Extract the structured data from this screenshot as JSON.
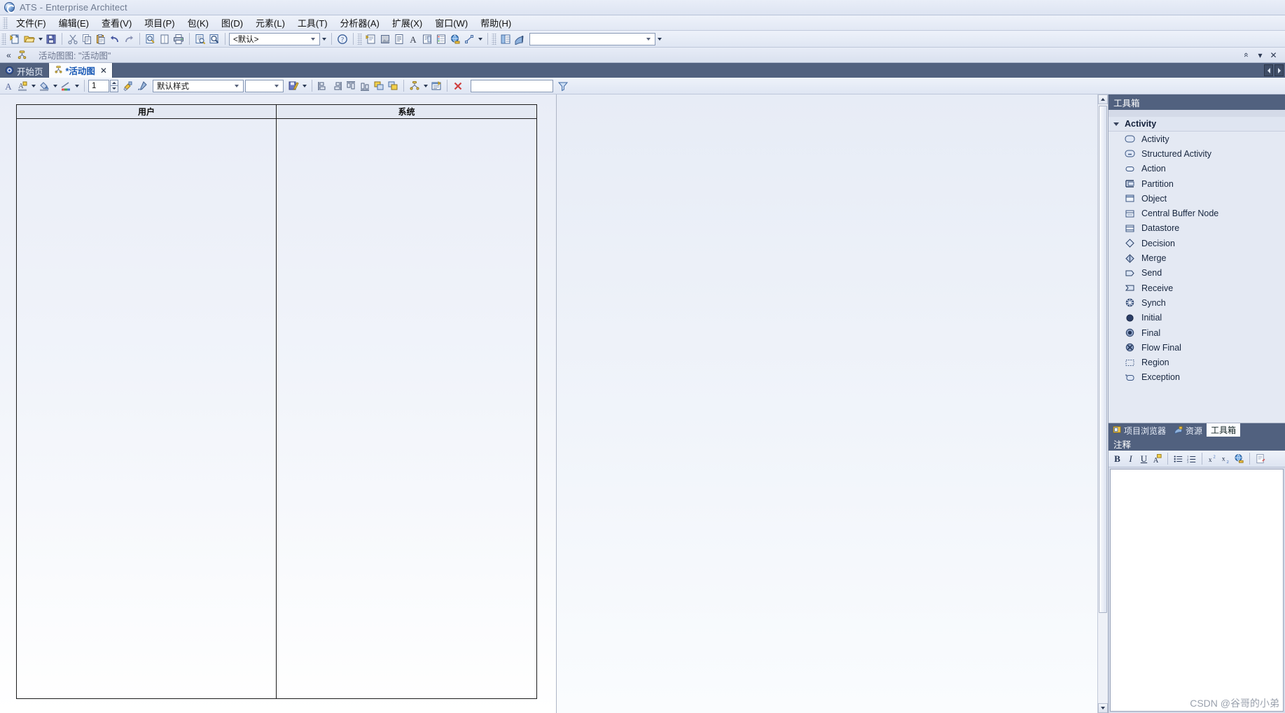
{
  "window": {
    "title": "ATS - Enterprise Architect",
    "logo_icon": "ea-logo-icon"
  },
  "menubar": {
    "items": [
      {
        "label": "文件(F)"
      },
      {
        "label": "编辑(E)"
      },
      {
        "label": "查看(V)"
      },
      {
        "label": "项目(P)"
      },
      {
        "label": "包(K)"
      },
      {
        "label": "图(D)"
      },
      {
        "label": "元素(L)"
      },
      {
        "label": "工具(T)"
      },
      {
        "label": "分析器(A)"
      },
      {
        "label": "扩展(X)"
      },
      {
        "label": "窗口(W)"
      },
      {
        "label": "帮助(H)"
      }
    ]
  },
  "main_toolbar": {
    "buttons": [
      {
        "name": "new-file-icon"
      },
      {
        "name": "open-file-icon"
      },
      {
        "name": "open-file-dropdown-icon"
      },
      {
        "name": "save-icon"
      },
      {
        "name": "cut-icon"
      },
      {
        "name": "copy-icon"
      },
      {
        "name": "paste-icon"
      },
      {
        "name": "undo-icon"
      },
      {
        "name": "redo-icon"
      },
      {
        "name": "find-in-project-icon"
      },
      {
        "name": "new-element-icon"
      },
      {
        "name": "print-icon"
      },
      {
        "name": "print-preview-icon"
      },
      {
        "name": "zoom-search-icon"
      },
      {
        "name": "help-icon"
      },
      {
        "name": "properties-icon"
      },
      {
        "name": "image-icon"
      },
      {
        "name": "notes-icon"
      },
      {
        "name": "font-icon"
      },
      {
        "name": "documentation-icon"
      },
      {
        "name": "tagged-values-icon"
      },
      {
        "name": "web-icon"
      },
      {
        "name": "relationships-icon"
      },
      {
        "name": "relationships-dropdown-icon"
      },
      {
        "name": "layout-icon"
      },
      {
        "name": "model-views-icon"
      }
    ],
    "perspective_combo": {
      "value": "<默认>",
      "name": "perspective-combo"
    },
    "search_combo": {
      "value": "",
      "name": "toolbar-search-combo"
    }
  },
  "breadcrumb": {
    "back_icon": "collapse-back-icon",
    "diagram_icon": "activity-diagram-icon",
    "text": "活动图图: \"活动图\"",
    "buttons": [
      {
        "name": "pin-up-icon",
        "glyph": "«"
      },
      {
        "name": "dropdown-icon",
        "glyph": "▾"
      },
      {
        "name": "close-icon",
        "glyph": "✕"
      }
    ]
  },
  "tabs": {
    "items": [
      {
        "label": "开始页",
        "icon": "start-page-icon",
        "active": false,
        "closable": false
      },
      {
        "label": "*活动图",
        "icon": "activity-diagram-icon",
        "active": true,
        "closable": true,
        "close_glyph": "✕"
      }
    ]
  },
  "format_toolbar": {
    "buttons": [
      {
        "name": "font-color-icon"
      },
      {
        "name": "text-highlight-icon"
      },
      {
        "name": "text-highlight-dropdown-icon"
      },
      {
        "name": "fill-color-icon"
      },
      {
        "name": "fill-color-dropdown-icon"
      },
      {
        "name": "line-style-icon"
      },
      {
        "name": "line-style-dropdown-icon"
      }
    ],
    "line_width": {
      "value": "1",
      "name": "line-width-spinner"
    },
    "brush_icon": "format-painter-icon",
    "picker_icon": "color-picker-icon",
    "style_combo": {
      "value": "默认样式",
      "name": "style-combo"
    },
    "empty_combo": {
      "value": "",
      "name": "secondary-style-combo"
    },
    "right_buttons": [
      {
        "name": "save-style-icon"
      },
      {
        "name": "save-style-dropdown-icon"
      },
      {
        "name": "align-left-icon"
      },
      {
        "name": "align-right-icon"
      },
      {
        "name": "align-top-icon"
      },
      {
        "name": "align-bottom-icon"
      },
      {
        "name": "same-width-icon"
      },
      {
        "name": "same-height-icon"
      },
      {
        "name": "auto-layout-icon"
      },
      {
        "name": "auto-layout-dropdown-icon"
      },
      {
        "name": "diagram-properties-icon"
      },
      {
        "name": "delete-icon"
      }
    ],
    "filter_input": {
      "value": "",
      "name": "filter-input"
    },
    "filter_icon": "funnel-filter-icon"
  },
  "diagram": {
    "name": "activity-diagram-canvas",
    "lanes": [
      {
        "label": "用户",
        "name": "swimlane-user"
      },
      {
        "label": "系统",
        "name": "swimlane-system"
      }
    ],
    "scrollbar": {
      "up_icon": "scroll-up-icon",
      "down_icon": "scroll-down-icon"
    }
  },
  "toolbox": {
    "title": "工具箱",
    "group": {
      "label": "Activity",
      "collapsed": false
    },
    "items": [
      {
        "label": "Activity",
        "icon": "activity-shape-icon"
      },
      {
        "label": "Structured Activity",
        "icon": "structured-activity-shape-icon"
      },
      {
        "label": "Action",
        "icon": "action-shape-icon"
      },
      {
        "label": "Partition",
        "icon": "partition-shape-icon"
      },
      {
        "label": "Object",
        "icon": "object-shape-icon"
      },
      {
        "label": "Central Buffer Node",
        "icon": "central-buffer-node-icon"
      },
      {
        "label": "Datastore",
        "icon": "datastore-icon"
      },
      {
        "label": "Decision",
        "icon": "decision-diamond-icon"
      },
      {
        "label": "Merge",
        "icon": "merge-diamond-icon"
      },
      {
        "label": "Send",
        "icon": "send-signal-icon"
      },
      {
        "label": "Receive",
        "icon": "receive-signal-icon"
      },
      {
        "label": "Synch",
        "icon": "synch-bar-icon"
      },
      {
        "label": "Initial",
        "icon": "initial-node-icon"
      },
      {
        "label": "Final",
        "icon": "final-node-icon"
      },
      {
        "label": "Flow Final",
        "icon": "flow-final-node-icon"
      },
      {
        "label": "Region",
        "icon": "region-icon"
      },
      {
        "label": "Exception",
        "icon": "exception-icon"
      }
    ],
    "dock_buttons": [
      {
        "name": "collapse-panel-icon",
        "glyph": "«"
      },
      {
        "name": "panel-menu-icon",
        "glyph": "▾"
      },
      {
        "name": "close-panel-icon",
        "glyph": "✕"
      }
    ]
  },
  "dock_tabs": {
    "items": [
      {
        "label": "项目浏览器",
        "icon": "project-browser-icon",
        "active": false
      },
      {
        "label": "资源",
        "icon": "resources-icon",
        "active": false
      },
      {
        "label": "工具箱",
        "icon": "toolbox-icon",
        "active": true
      }
    ]
  },
  "notes": {
    "title": "注释",
    "toolbar": [
      {
        "name": "bold-icon",
        "glyph": "B"
      },
      {
        "name": "italic-icon",
        "glyph": "I"
      },
      {
        "name": "underline-icon",
        "glyph": "U"
      },
      {
        "name": "text-color-icon",
        "glyph": "A"
      },
      {
        "name": "bullet-list-icon"
      },
      {
        "name": "numbered-list-icon"
      },
      {
        "name": "superscript-icon"
      },
      {
        "name": "subscript-icon"
      },
      {
        "name": "hyperlink-icon"
      },
      {
        "name": "insert-note-icon"
      }
    ],
    "content": ""
  },
  "watermark": {
    "text": "CSDN @谷哥的小弟"
  },
  "colors": {
    "title_bar": "#e9eef8",
    "dock_header": "#51617f",
    "accent_blue": "#1657b5",
    "toolbox_bg": "#e4e9f3",
    "canvas_bg": "#eef2f9"
  }
}
